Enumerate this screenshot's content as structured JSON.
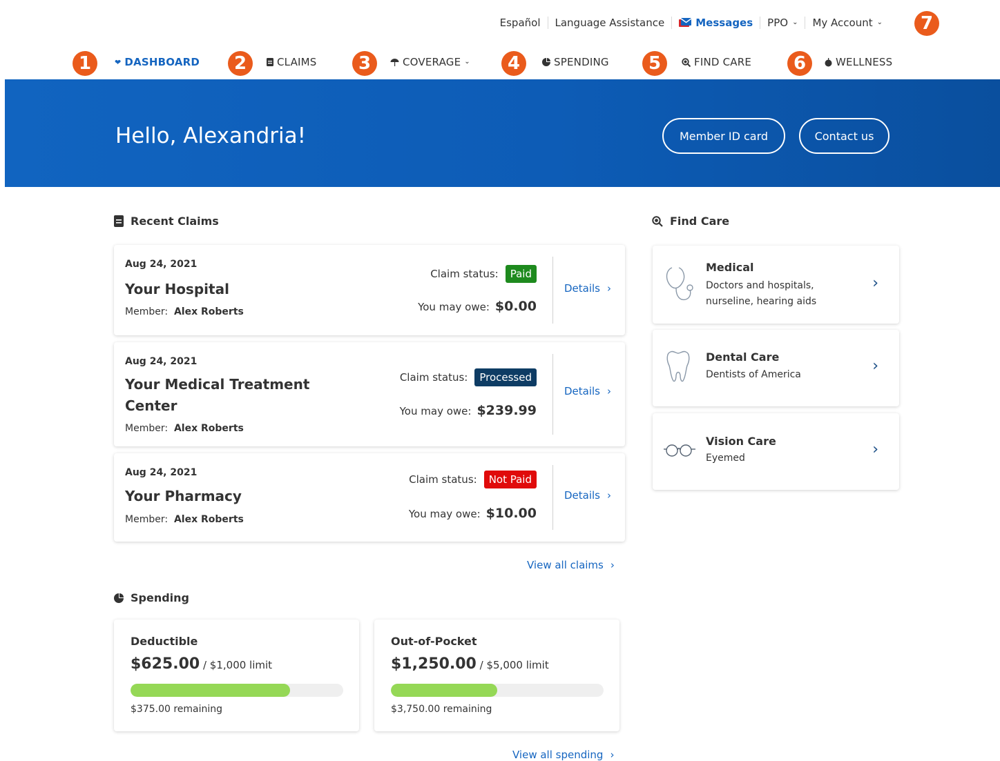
{
  "utility_nav": {
    "espanol": "Español",
    "language_assistance": "Language Assistance",
    "messages": "Messages",
    "plan": "PPO",
    "account": "My Account"
  },
  "badges": [
    "1",
    "2",
    "3",
    "4",
    "5",
    "6",
    "7"
  ],
  "main_nav": {
    "dashboard": "DASHBOARD",
    "claims": "CLAIMS",
    "coverage": "COVERAGE",
    "spending": "SPENDING",
    "find_care": "FIND CARE",
    "wellness": "WELLNESS"
  },
  "hero": {
    "greeting": "Hello, Alexandria!",
    "member_id_button": "Member ID card",
    "contact_button": "Contact us"
  },
  "recent_claims": {
    "title": "Recent Claims",
    "status_label": "Claim status:",
    "owe_label": "You may owe:",
    "member_label": "Member:",
    "details_label": "Details",
    "view_all": "View all claims",
    "items": [
      {
        "date": "Aug 24, 2021",
        "provider": "Your Hospital",
        "member": "Alex Roberts",
        "status": "Paid",
        "status_color": "#1e8a1e",
        "owe": "$0.00"
      },
      {
        "date": "Aug 24, 2021",
        "provider": "Your Medical Treatment Center",
        "member": "Alex Roberts",
        "status": "Processed",
        "status_color": "#0e3c64",
        "owe": "$239.99"
      },
      {
        "date": "Aug 24, 2021",
        "provider": "Your Pharmacy",
        "member": "Alex Roberts",
        "status": "Not Paid",
        "status_color": "#e00b0b",
        "owe": "$10.00"
      }
    ]
  },
  "spending": {
    "title": "Spending",
    "view_all": "View all spending",
    "items": [
      {
        "title": "Deductible",
        "amount": "$625.00",
        "limit": " / $1,000 limit",
        "remaining": "$375.00 remaining",
        "progress": 0.75
      },
      {
        "title": "Out-of-Pocket",
        "amount": "$1,250.00",
        "limit": " / $5,000 limit",
        "remaining": "$3,750.00 remaining",
        "progress": 0.5
      }
    ]
  },
  "find_care": {
    "title": "Find Care",
    "items": [
      {
        "title": "Medical",
        "desc": "Doctors and hospitals, nurseline, hearing aids",
        "icon": "stethoscope-icon"
      },
      {
        "title": "Dental Care",
        "desc": "Dentists of America",
        "icon": "tooth-icon"
      },
      {
        "title": "Vision Care",
        "desc": "Eyemed",
        "icon": "glasses-icon"
      }
    ]
  },
  "colors": {
    "brand_blue": "#1565c0",
    "badge_orange": "#ea5b1c",
    "progress_green": "#95d856"
  }
}
